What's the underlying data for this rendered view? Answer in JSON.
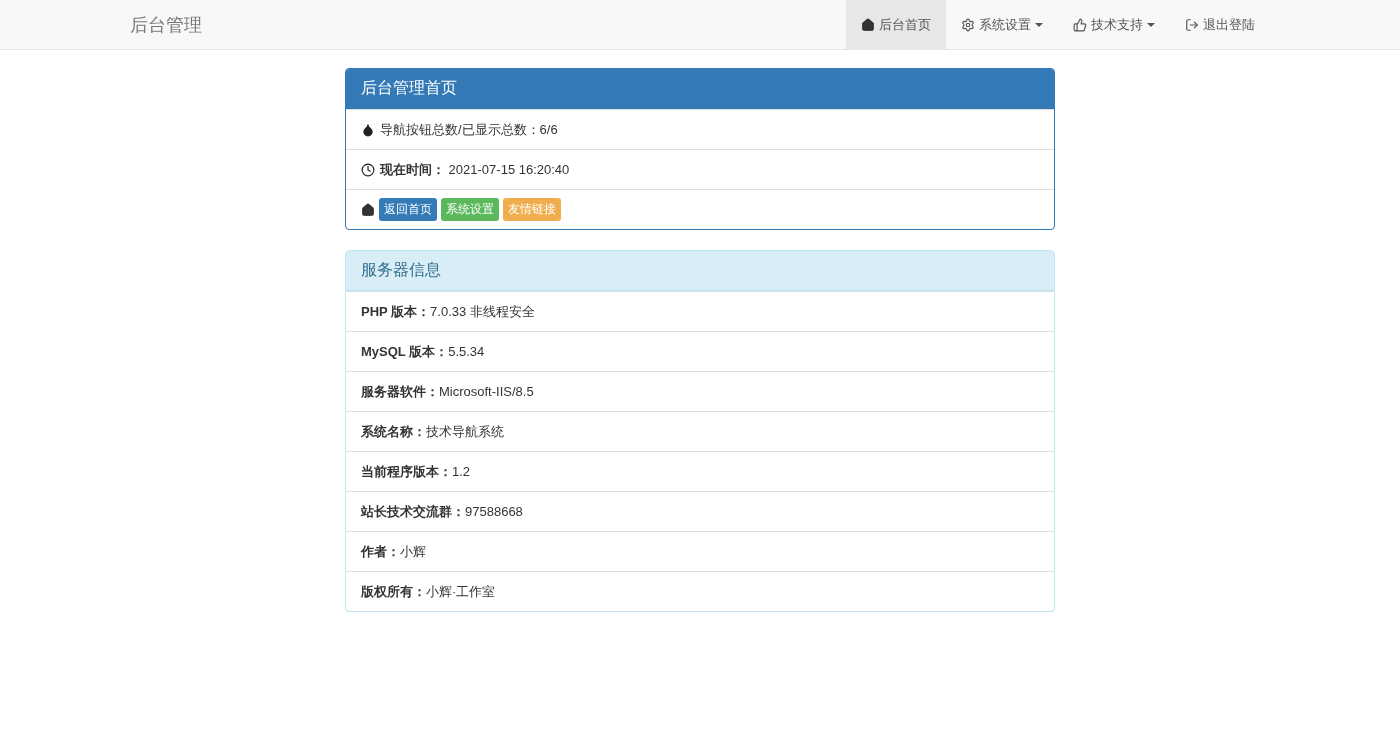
{
  "navbar": {
    "brand": "后台管理",
    "items": [
      {
        "label": "后台首页",
        "kind": "home",
        "selected": true,
        "dropdown": false
      },
      {
        "label": "系统设置",
        "kind": "settings",
        "selected": false,
        "dropdown": true
      },
      {
        "label": "技术支持",
        "kind": "support",
        "selected": false,
        "dropdown": true
      },
      {
        "label": "退出登陆",
        "kind": "logout",
        "selected": false,
        "dropdown": false
      }
    ]
  },
  "home_panel": {
    "title": "后台管理首页",
    "rows": [
      {
        "kind": "count",
        "text": "导航按钮总数/已显示总数：6/6"
      },
      {
        "kind": "time",
        "text": "**现在时间：** 2021-07-15 16:20:40"
      },
      {
        "kind": "links",
        "buttons": [
          {
            "label": "返回首页",
            "color": "#337ab7"
          },
          {
            "label": "系统设置",
            "color": "#5cb85c"
          },
          {
            "label": "友情链接",
            "color": "#f0ad4e"
          }
        ]
      }
    ]
  },
  "server_panel": {
    "title": "服务器信息",
    "rows": [
      "**PHP 版本：**7.0.33 非线程安全",
      "**MySQL 版本：**5.5.34",
      "**服务器软件：**Microsoft-IIS/8.5",
      "**系统名称：**技术导航系统",
      "**当前程序版本：**1.2",
      "**站长技术交流群：**97588668",
      "**作者：**小辉",
      "**版权所有：**小辉·工作室"
    ]
  }
}
